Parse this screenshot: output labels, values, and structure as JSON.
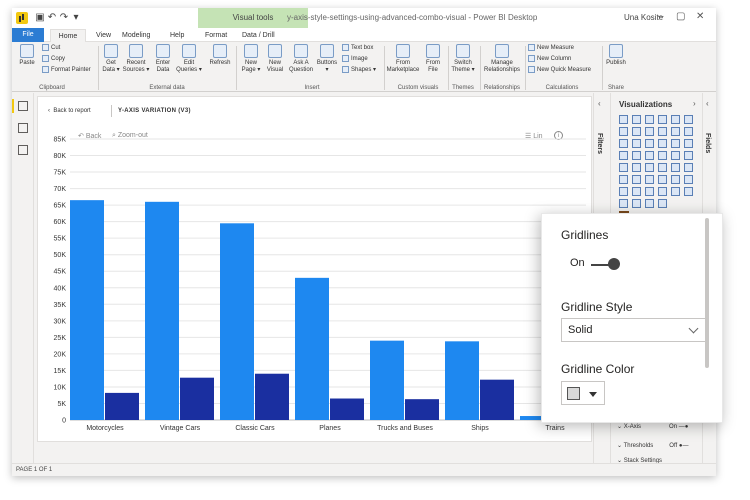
{
  "window": {
    "title": "y-axis-style-settings-using-advanced-combo-visual - Power BI Desktop",
    "user": "Una Kosite",
    "visual_tools": "Visual tools"
  },
  "tabs": [
    {
      "label": "File"
    },
    {
      "label": "Home"
    },
    {
      "label": "View"
    },
    {
      "label": "Modeling"
    },
    {
      "label": "Help"
    },
    {
      "label": "Format"
    },
    {
      "label": "Data / Drill"
    }
  ],
  "ribbon": {
    "paste": "Paste",
    "cut": "Cut",
    "copy": "Copy",
    "format_painter": "Format Painter",
    "get_data": "Get Data ▾",
    "recent_sources": "Recent Sources ▾",
    "enter_data": "Enter Data",
    "edit_queries": "Edit Queries ▾",
    "refresh": "Refresh",
    "new_page": "New Page ▾",
    "new_visual": "New Visual",
    "ask_question": "Ask A Question",
    "buttons": "Buttons ▾",
    "text_box": "Text box",
    "image": "Image",
    "shapes": "Shapes ▾",
    "from_marketplace": "From Marketplace",
    "from_file": "From File",
    "switch_theme": "Switch Theme ▾",
    "manage_relationships": "Manage Relationships",
    "new_measure": "New Measure",
    "new_column": "New Column",
    "new_quick_measure": "New Quick Measure",
    "publish": "Publish",
    "groups": {
      "clipboard": "Clipboard",
      "external_data": "External data",
      "insert": "Insert",
      "custom_visuals": "Custom visuals",
      "themes": "Themes",
      "relationships": "Relationships",
      "calculations": "Calculations",
      "share": "Share"
    }
  },
  "report": {
    "back": "Back to report",
    "visual_title": "Y-AXIS VARIATION (V3)",
    "nav_back": "Back",
    "zoom_out": "Zoom-out",
    "lin": "Lin",
    "info": "i"
  },
  "panes": {
    "filters": "Filters",
    "visualizations": "Visualizations",
    "fields": "Fields",
    "x_axis": "X-Axis",
    "x_axis_state": "On",
    "thresholds": "Thresholds",
    "thresholds_state": "Off",
    "stack_settings": "Stack Settings"
  },
  "status": {
    "page": "PAGE 1 OF 1"
  },
  "popup": {
    "gridlines_label": "Gridlines",
    "gridlines_state": "On",
    "style_label": "Gridline Style",
    "style_value": "Solid",
    "color_label": "Gridline Color",
    "color_value": "#d9d9d9"
  },
  "colors": {
    "series_1": "#1e88f0",
    "series_2": "#1a2fa0",
    "file_tab": "#2b7cd3",
    "visual_tools": "#c5e3b5"
  },
  "chart_data": {
    "type": "bar",
    "categories": [
      "Motorcycles",
      "Vintage Cars",
      "Classic Cars",
      "Planes",
      "Trucks and Buses",
      "Ships",
      "Trains"
    ],
    "series": [
      {
        "values": [
          66500,
          66000,
          59500,
          43000,
          24000,
          23800,
          1200
        ]
      },
      {
        "values": [
          8200,
          12800,
          14000,
          6500,
          6300,
          12200,
          0
        ]
      }
    ],
    "yticks": [
      "0",
      "5K",
      "10K",
      "15K",
      "20K",
      "25K",
      "30K",
      "35K",
      "40K",
      "45K",
      "50K",
      "55K",
      "60K",
      "65K",
      "70K",
      "75K",
      "80K",
      "85K"
    ],
    "ylim": [
      0,
      85000
    ],
    "grid": true,
    "xlabel": "",
    "ylabel": ""
  }
}
